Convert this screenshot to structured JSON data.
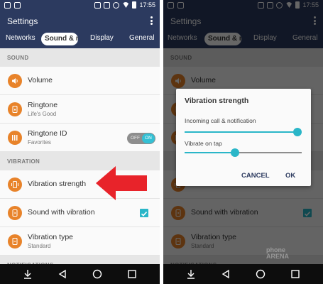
{
  "status": {
    "time": "17:55"
  },
  "appbar": {
    "title": "Settings"
  },
  "tabs": [
    {
      "label": "Networks"
    },
    {
      "label": "Sound & n"
    },
    {
      "label": "Display"
    },
    {
      "label": "General"
    }
  ],
  "sections": {
    "sound": "SOUND",
    "vibration": "VIBRATION",
    "notifications": "NOTIFICATIONS"
  },
  "items": {
    "volume": {
      "label": "Volume"
    },
    "ringtone": {
      "label": "Ringtone",
      "sub": "Life's Good"
    },
    "ringtone_id": {
      "label": "Ringtone ID",
      "sub": "Favorites",
      "toggle_off": "OFF",
      "toggle_on": "ON",
      "state": "on"
    },
    "vibration_strength": {
      "label": "Vibration strength"
    },
    "sound_with_vibration": {
      "label": "Sound with vibration",
      "checked": true
    },
    "vibration_type": {
      "label": "Vibration type",
      "sub": "Standard"
    }
  },
  "dialog": {
    "title": "Vibration strength",
    "incoming": {
      "label": "Incoming call & notification",
      "level_percent": 100
    },
    "tap": {
      "label": "Vibrate on tap",
      "level_percent": 43
    },
    "cancel": "CANCEL",
    "ok": "OK"
  },
  "watermark": {
    "line1": "phone",
    "line2": "ARENA"
  },
  "colors": {
    "appbar": "#2c3a5f",
    "accent": "#2ab6c8",
    "icon_orange": "#e8832a",
    "arrow_red": "#e8232a"
  },
  "icons": {
    "volume": "speaker-icon",
    "ringtone": "ringtone-icon",
    "ringtone_id": "contact-icon",
    "vibration_strength": "vibrate-icon",
    "sound_with_vibration": "sound-vibrate-icon",
    "vibration_type": "vibrate-type-icon"
  }
}
